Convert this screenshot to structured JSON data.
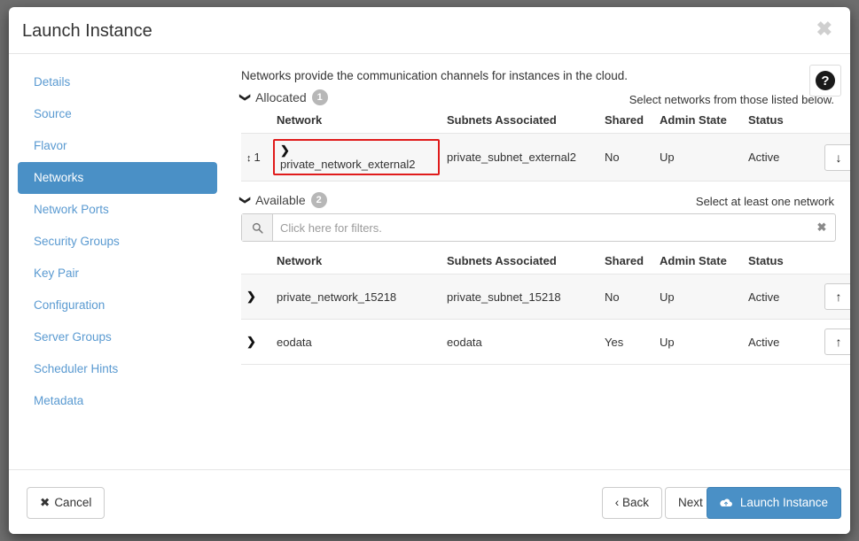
{
  "dialog": {
    "title": "Launch Instance",
    "close_label": "✖"
  },
  "sidebar": {
    "items": [
      {
        "label": "Details",
        "active": false
      },
      {
        "label": "Source",
        "active": false
      },
      {
        "label": "Flavor",
        "active": false
      },
      {
        "label": "Networks",
        "active": true
      },
      {
        "label": "Network Ports",
        "active": false
      },
      {
        "label": "Security Groups",
        "active": false
      },
      {
        "label": "Key Pair",
        "active": false
      },
      {
        "label": "Configuration",
        "active": false
      },
      {
        "label": "Server Groups",
        "active": false
      },
      {
        "label": "Scheduler Hints",
        "active": false
      },
      {
        "label": "Metadata",
        "active": false
      }
    ]
  },
  "content": {
    "intro": "Networks provide the communication channels for instances in the cloud.",
    "help_glyph": "?",
    "allocated": {
      "caret": "⌄",
      "label": "Allocated",
      "count": "1",
      "hint": "Select networks from those listed below.",
      "columns": [
        "",
        "Network",
        "Subnets Associated",
        "Shared",
        "Admin State",
        "Status",
        ""
      ],
      "rows": [
        {
          "order": "1",
          "sort_icon": "↕",
          "chevron": "❯",
          "network": "private_network_external2",
          "subnet": "private_subnet_external2",
          "shared": "No",
          "admin_state": "Up",
          "status": "Active",
          "action_icon": "↓",
          "highlighted": true
        }
      ]
    },
    "available": {
      "caret": "⌄",
      "label": "Available",
      "count": "2",
      "hint": "Select at least one network",
      "filter": {
        "placeholder": "Click here for filters.",
        "value": "",
        "search_icon": "🔍",
        "clear_icon": "✖"
      },
      "columns": [
        "",
        "Network",
        "Subnets Associated",
        "Shared",
        "Admin State",
        "Status",
        ""
      ],
      "rows": [
        {
          "chevron": "❯",
          "network": "private_network_15218",
          "subnet": "private_subnet_15218",
          "shared": "No",
          "admin_state": "Up",
          "status": "Active",
          "action_icon": "↑"
        },
        {
          "chevron": "❯",
          "network": "eodata",
          "subnet": "eodata",
          "shared": "Yes",
          "admin_state": "Up",
          "status": "Active",
          "action_icon": "↑"
        }
      ]
    }
  },
  "footer": {
    "cancel": "Cancel",
    "cancel_icon": "✖",
    "back": "‹ Back",
    "next": "Next ›",
    "launch": "Launch Instance",
    "launch_icon": "☁"
  },
  "colors": {
    "accent": "#4a90c6",
    "link": "#5a9ad1",
    "highlight": "#e01b1b",
    "badge": "#b7b7b7",
    "backdrop": "#6e6e6e"
  }
}
